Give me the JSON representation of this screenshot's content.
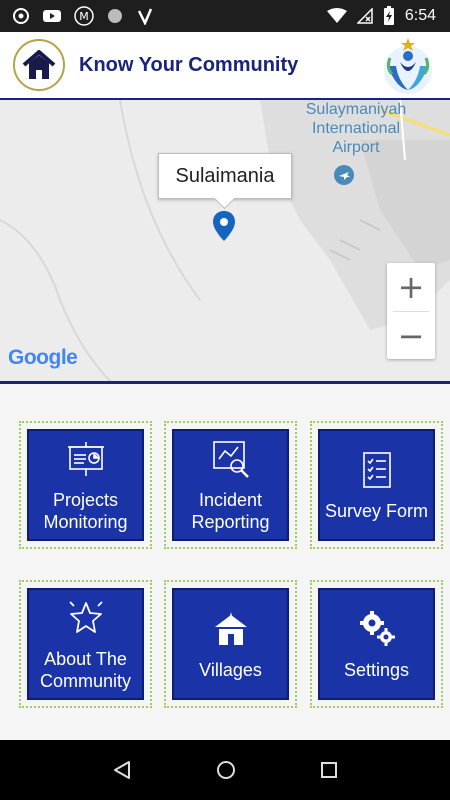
{
  "status_bar": {
    "time": "6:54"
  },
  "app_bar": {
    "title": "Know Your Community"
  },
  "map": {
    "airport_label": "Sulaymaniyah\nInternational\nAirport",
    "marker_title": "Sulaimania",
    "zoom_in": "+",
    "zoom_out": "−",
    "attribution": "Google"
  },
  "tiles": [
    {
      "label": "Projects Monitoring",
      "icon": "presentation-chart-icon"
    },
    {
      "label": "Incident Reporting",
      "icon": "analytics-search-icon"
    },
    {
      "label": "Survey Form",
      "icon": "clipboard-checklist-icon"
    },
    {
      "label": "About The Community",
      "icon": "star-icon"
    },
    {
      "label": "Villages",
      "icon": "hut-icon"
    },
    {
      "label": "Settings",
      "icon": "gears-icon"
    }
  ],
  "colors": {
    "primary": "#1a237e",
    "tile": "#1a34a8",
    "tile_border": "#9ccc65"
  }
}
